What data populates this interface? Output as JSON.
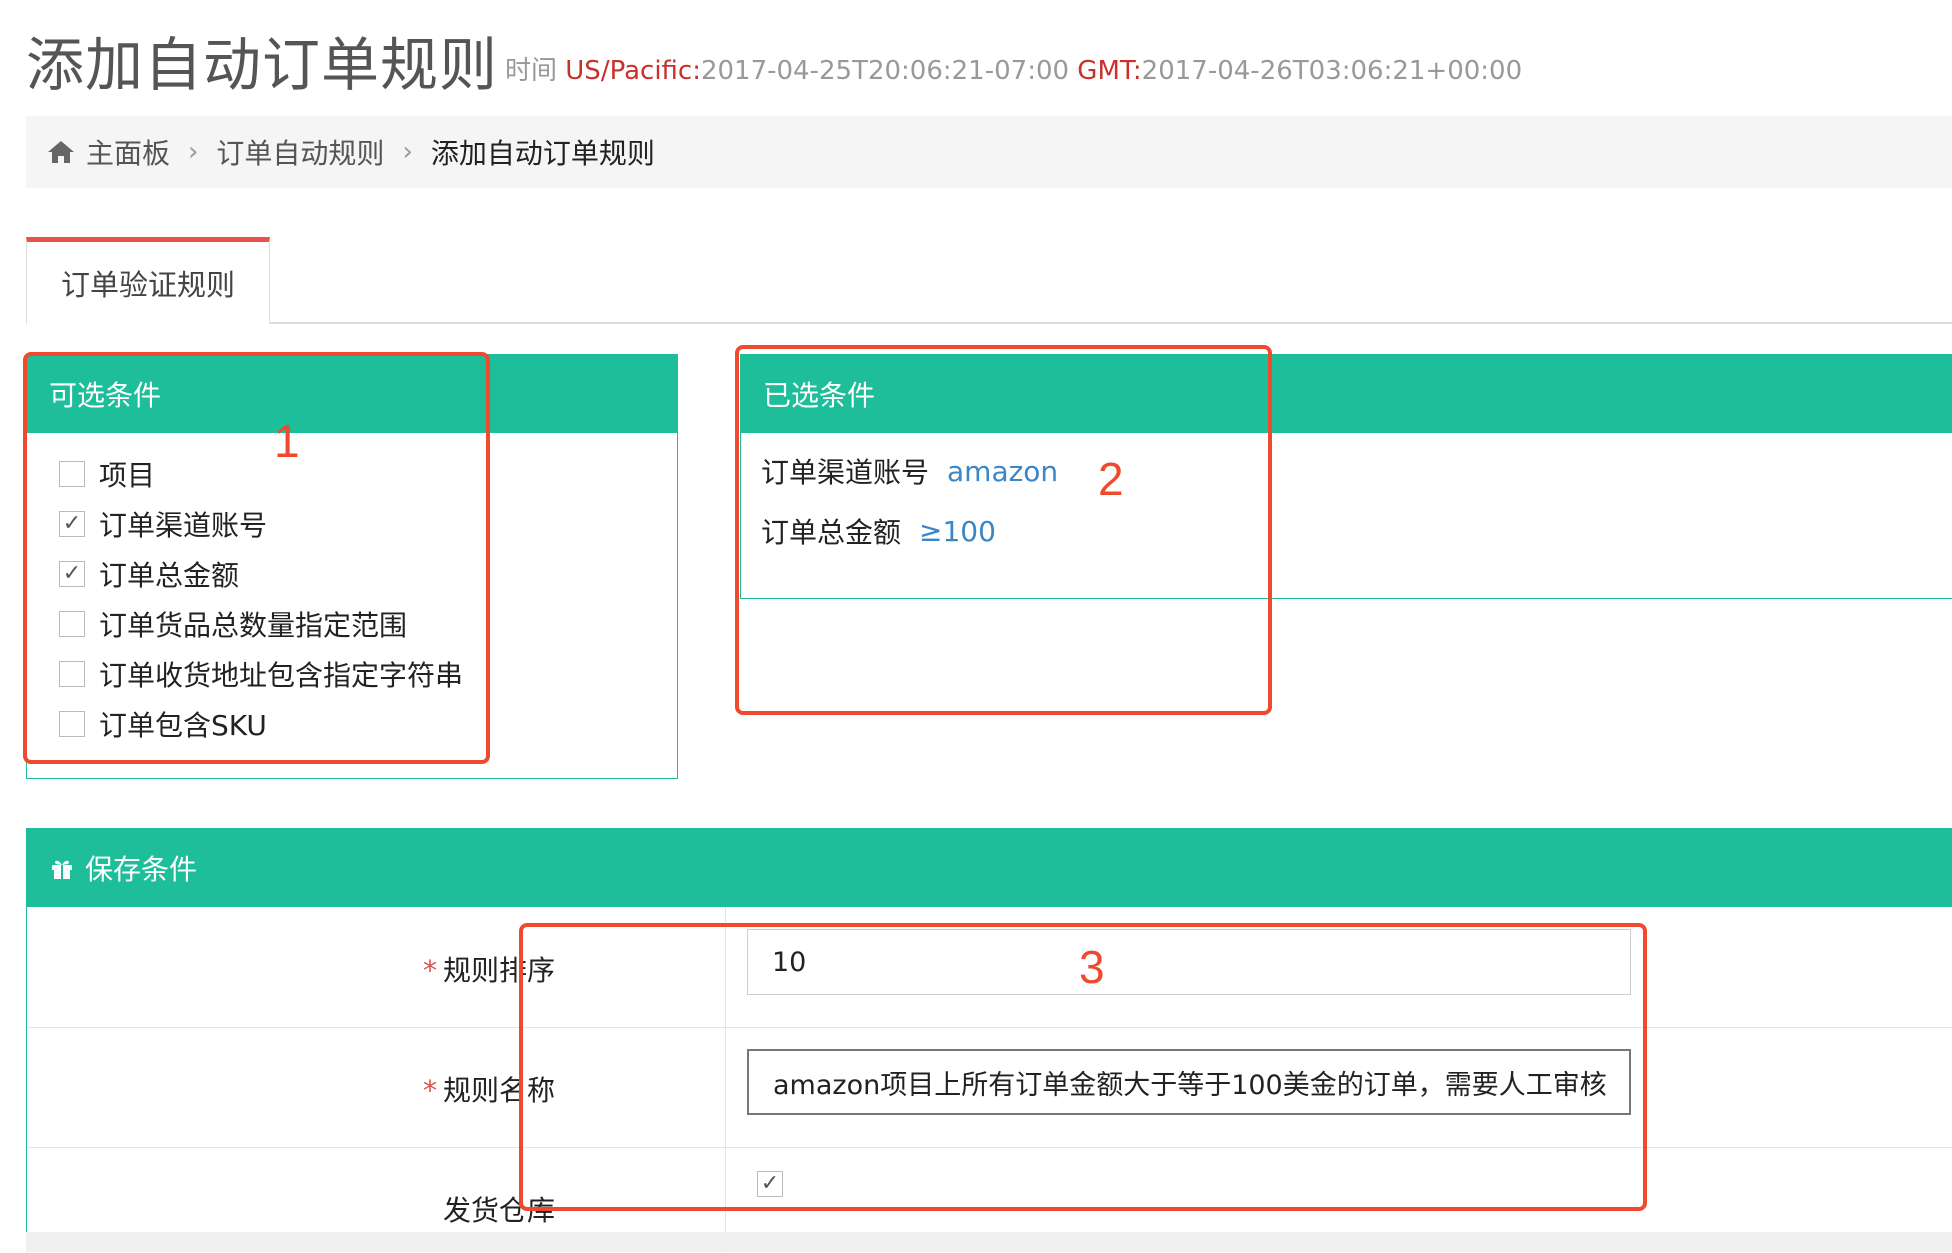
{
  "header": {
    "title": "添加自动订单规则",
    "time_label": "时间",
    "tz1_label": "US/Pacific:",
    "tz1_value": "2017-04-25T20:06:21-07:00",
    "tz2_label": "GMT:",
    "tz2_value": "2017-04-26T03:06:21+00:00"
  },
  "breadcrumb": {
    "home_icon": "home-icon",
    "items": [
      "主面板",
      "订单自动规则",
      "添加自动订单规则"
    ]
  },
  "tabs": [
    {
      "label": "订单验证规则",
      "active": true
    }
  ],
  "available_conditions": {
    "title": "可选条件",
    "items": [
      {
        "label": "项目",
        "checked": false
      },
      {
        "label": "订单渠道账号",
        "checked": true
      },
      {
        "label": "订单总金额",
        "checked": true
      },
      {
        "label": "订单货品总数量指定范围",
        "checked": false
      },
      {
        "label": "订单收货地址包含指定字符串",
        "checked": false
      },
      {
        "label": "订单包含SKU",
        "checked": false
      }
    ]
  },
  "selected_conditions": {
    "title": "已选条件",
    "items": [
      {
        "label": "订单渠道账号",
        "value": "amazon"
      },
      {
        "label": "订单总金额",
        "value": "≥100"
      }
    ]
  },
  "save_conditions": {
    "title": "保存条件",
    "icon": "gift-icon",
    "fields": {
      "rule_order": {
        "label": "规则排序",
        "value": "10"
      },
      "rule_name": {
        "label": "规则名称",
        "value": "amazon项目上所有订单金额大于等于100美金的订单，需要人工审核"
      },
      "warehouse": {
        "label": "发货仓库",
        "checked": true
      }
    }
  },
  "annotations": [
    "1",
    "2",
    "3"
  ],
  "colors": {
    "accent": "#1ebe9a",
    "annotation": "#ef4a2d",
    "link": "#3a86c8",
    "tab_top": "#e9514f"
  }
}
